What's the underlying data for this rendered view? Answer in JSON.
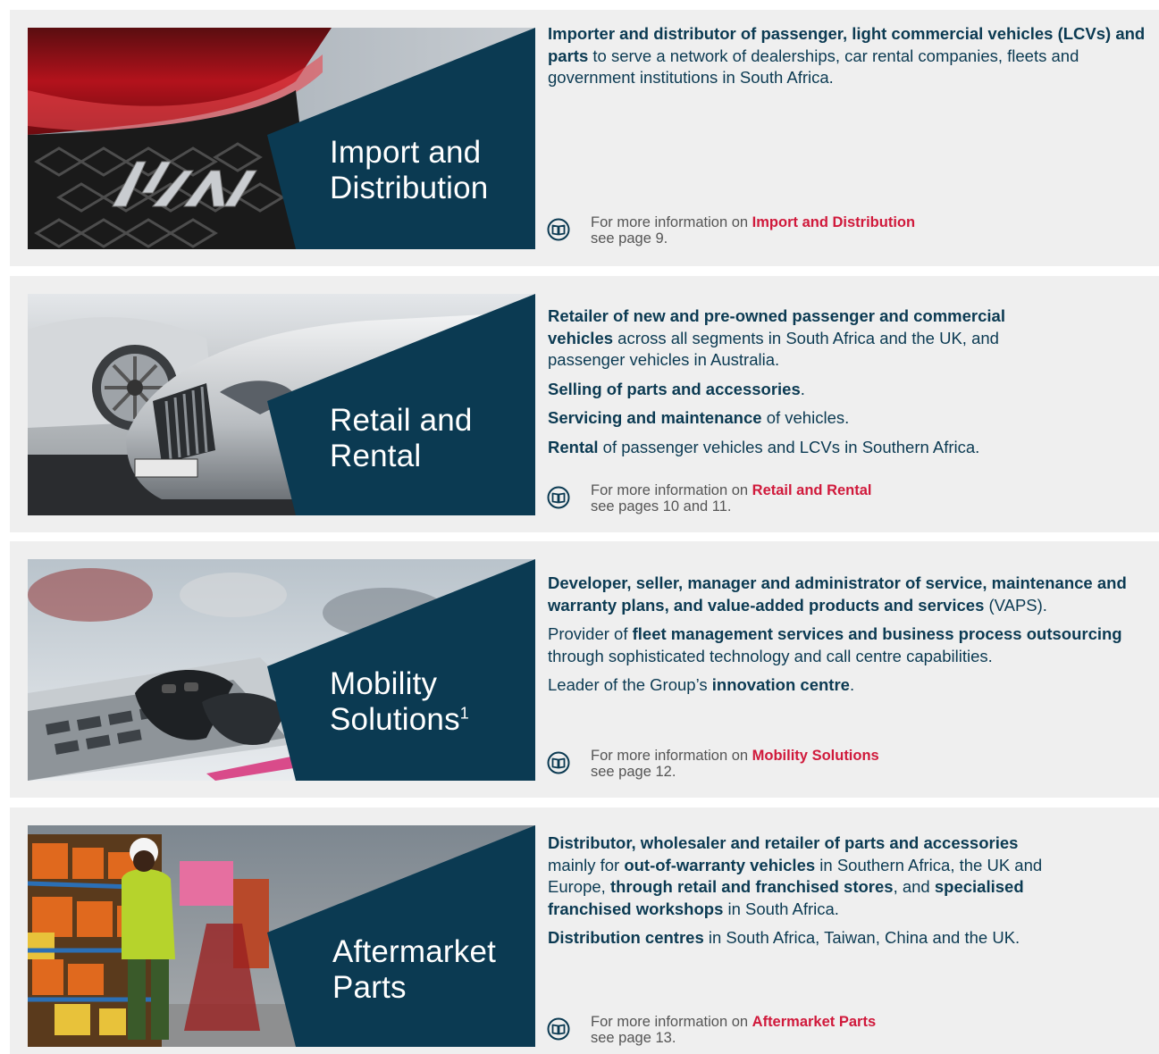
{
  "colors": {
    "navy": "#0b3a52",
    "accent_red": "#d0193b",
    "panel_bg": "#efefef"
  },
  "sections": [
    {
      "title_line1": "Import and",
      "title_line2": "Distribution",
      "para1_bold": "Importer and distributor of passenger, light commercial vehicles (LCVs) and parts",
      "para1_rest": " to serve a network of dealerships, car rental companies, fleets and government institutions in South Africa.",
      "info_prefix": "For more information on ",
      "info_link": "Import and Distribution",
      "info_page": "see page 9.",
      "icon": "book-icon"
    },
    {
      "title_line1": "Retail and",
      "title_line2": "Rental",
      "p1_bold": "Retailer of new and pre-owned passenger and commercial vehicles",
      "p1_rest": " across all segments in South Africa and the UK, and passenger vehicles in Australia.",
      "p2_bold": "Selling of parts and accessories",
      "p2_rest": ".",
      "p3_bold": "Servicing and maintenance",
      "p3_rest": " of vehicles.",
      "p4_bold": "Rental",
      "p4_rest": " of passenger vehicles and LCVs in Southern Africa.",
      "info_prefix": "For more information on ",
      "info_link": "Retail and Rental",
      "info_page": "see pages 10 and 11.",
      "icon": "book-icon"
    },
    {
      "title_line1": "Mobility",
      "title_line2": "Solutions",
      "title_sup": "1",
      "p1_bold": "Developer, seller, manager and administrator of service, maintenance and warranty plans, and value-added products and services",
      "p1_rest": " (VAPS).",
      "p2_pre": "Provider of ",
      "p2_bold": "fleet management services and business process outsourcing",
      "p2_rest": " through sophisticated technology and call centre capabilities.",
      "p3_pre": "Leader of the Group’s ",
      "p3_bold": "innovation centre",
      "p3_rest": ".",
      "info_prefix": "For more information on ",
      "info_link": "Mobility Solutions",
      "info_page": "see page 12.",
      "icon": "book-icon"
    },
    {
      "title_line1": "Aftermarket",
      "title_line2": "Parts",
      "p1_bold": "Distributor, wholesaler and retailer of parts and accessories",
      "p1_a": " mainly for ",
      "p1_b_bold": "out-of-warranty vehicles",
      "p1_c": " in Southern Africa, the UK and Europe, ",
      "p1_d_bold": "through retail and franchised stores",
      "p1_e": ", and ",
      "p1_f_bold": "specialised franchised workshops",
      "p1_g": " in South Africa.",
      "p2_bold": "Distribution centres",
      "p2_rest": " in South Africa, Taiwan, China and the UK.",
      "info_prefix": "For more information on ",
      "info_link": "Aftermarket Parts",
      "info_page": "see page 13.",
      "icon": "book-icon"
    }
  ]
}
